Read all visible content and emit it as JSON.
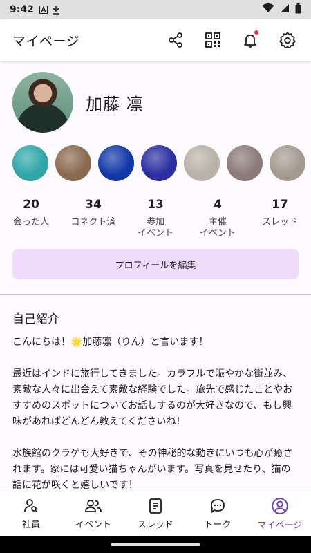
{
  "status_bar": {
    "time": "9:42"
  },
  "app_bar": {
    "title": "マイページ"
  },
  "profile": {
    "name": "加藤 凛"
  },
  "photos": [
    {
      "name": "photo-sea-bridge",
      "color": "#2fa6a8"
    },
    {
      "name": "photo-cat",
      "color": "#8a6a4f"
    },
    {
      "name": "photo-aquarium",
      "color": "#1238a8"
    },
    {
      "name": "photo-jellyfish",
      "color": "#2a2ea0"
    },
    {
      "name": "photo-taj-mahal",
      "color": "#b8b2a8"
    },
    {
      "name": "photo-river-sunset",
      "color": "#8a7a78"
    },
    {
      "name": "photo-ghats",
      "color": "#a59a90"
    }
  ],
  "stats": [
    {
      "num": "20",
      "label": "会った人"
    },
    {
      "num": "34",
      "label": "コネクト済"
    },
    {
      "num": "13",
      "label": "参加\nイベント"
    },
    {
      "num": "4",
      "label": "主催\nイベント"
    },
    {
      "num": "17",
      "label": "スレッド"
    }
  ],
  "edit_button": "プロフィールを編集",
  "about": {
    "heading": "自己紹介",
    "paragraphs": [
      "こんにちは！🌟加藤凛（りん）と言います！",
      "最近はインドに旅行してきました。カラフルで賑やかな街並み、素敵な人々に出会えて素敵な経験でした。旅先で感じたことやおすすめのスポットについてお話しするのが大好きなので、もし興味があればどんどん教えてくださいね！",
      "水族館のクラゲも大好きで、その神秘的な動きにいつも心が癒されます。家には可愛い猫ちゃんがいます。写真を見せたり、猫の話に花が咲くと嬉しいです！"
    ]
  },
  "nav": [
    {
      "label": "社員",
      "icon": "person-search-icon"
    },
    {
      "label": "イベント",
      "icon": "group-icon"
    },
    {
      "label": "スレッド",
      "icon": "document-icon"
    },
    {
      "label": "トーク",
      "icon": "chat-icon"
    },
    {
      "label": "マイページ",
      "icon": "account-circle-icon",
      "active": true
    }
  ],
  "colors": {
    "accent": "#6a3fb5",
    "edit_button_bg": "#efdcfc",
    "badge": "#e53935"
  }
}
